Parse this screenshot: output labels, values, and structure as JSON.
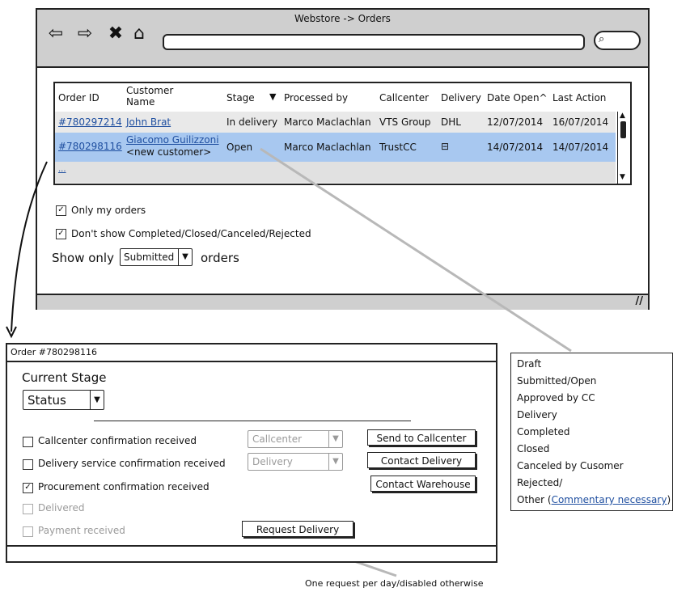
{
  "window": {
    "title": "Webstore -> Orders",
    "address": ""
  },
  "icons": {
    "back": "back-arrow-icon",
    "forward": "forward-arrow-icon",
    "stop": "close-icon",
    "home": "home-icon",
    "search": "search-icon",
    "resize": "resize-grip-icon",
    "sort_desc": "sort-down-triangle-icon"
  },
  "table": {
    "headers": {
      "order_id": "Order ID",
      "customer": "Customer\nName",
      "stage": "Stage",
      "processed_by": "Processed by",
      "callcenter": "Callcenter",
      "delivery": "Delivery",
      "date_open": "Date Open^",
      "last_action": "Last Action"
    },
    "rows": [
      {
        "order_id": "#780297214",
        "customer": "John Brat",
        "customer_note": "",
        "stage": "In delivery",
        "processed_by": "Marco Maclachlan",
        "callcenter": "VTS Group",
        "delivery": "DHL",
        "date_open": "12/07/2014",
        "last_action": "16/07/2014"
      },
      {
        "order_id": "#780298116",
        "customer": "Giacomo Guilizzoni",
        "customer_note": "<new customer>",
        "stage": "Open",
        "processed_by": "Marco Maclachlan",
        "callcenter": "TrustCC",
        "delivery": "⊟",
        "date_open": "14/07/2014",
        "last_action": "14/07/2014"
      }
    ],
    "more_link": "..."
  },
  "filters": {
    "only_my_orders": "Only my orders",
    "dont_show": "Don't show Completed/Closed/Canceled/Rejected",
    "show_only_prefix": "Show only",
    "show_only_value": "Submitted",
    "show_only_suffix": "orders"
  },
  "order_panel": {
    "title": "Order #780298116",
    "current_stage_label": "Current Stage",
    "status_value": "Status",
    "checks": {
      "callcenter": "Callcenter confirmation received",
      "delivery": "Delivery service confirmation received",
      "procurement": "Procurement confirmation received",
      "delivered": "Delivered",
      "payment": "Payment received"
    },
    "callcenter_select": "Callcenter",
    "delivery_select": "Delivery",
    "buttons": {
      "send_callcenter": "Send to Callcenter",
      "contact_delivery": "Contact Delivery",
      "contact_warehouse": "Contact Warehouse",
      "request_delivery": "Request Delivery"
    }
  },
  "stage_list": {
    "items": [
      "Draft",
      "Submitted/Open",
      "Approved by CC",
      "Delivery",
      "Completed",
      "Closed",
      "Canceled by Cusomer",
      "Rejected/"
    ],
    "other_prefix": "Other (",
    "other_link": "Commentary necessary",
    "other_suffix": ")"
  },
  "annotation": "One request per day/disabled otherwise",
  "colors": {
    "selected_row": "#a8c8f0",
    "link": "#1f4fa0",
    "chrome": "#cfcfcf"
  }
}
